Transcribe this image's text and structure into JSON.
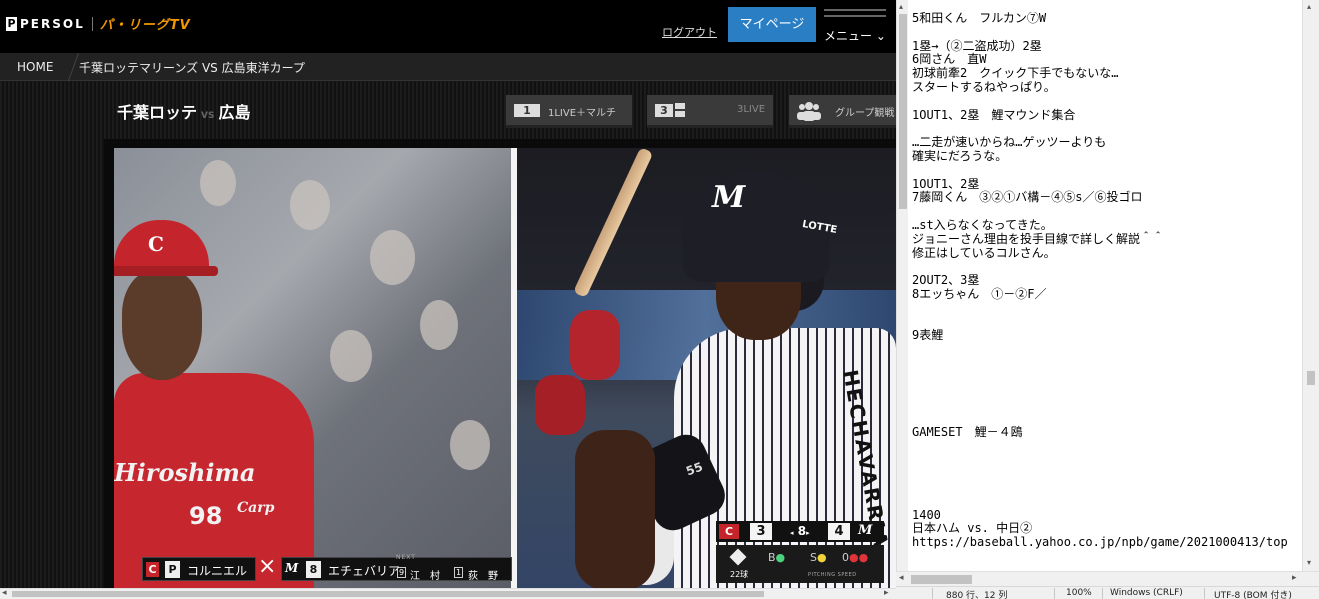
{
  "browser": {
    "site": {
      "logo_text": "PERSOL",
      "logo_tv": "パ・リーグTV",
      "logout_label": "ログアウト",
      "mypage_label": "マイページ",
      "menu_label": "メニュー"
    },
    "breadcrumb": {
      "home": "HOME",
      "current": "千葉ロッテマリーンズ VS 広島東洋カープ"
    },
    "game": {
      "home_team": "千葉ロッテ",
      "vs": "VS",
      "away_team": "広島"
    },
    "view_buttons": [
      {
        "num": "1",
        "label": "1LIVE＋マルチ"
      },
      {
        "num": "3",
        "label": "3LIVE"
      },
      {
        "num": "",
        "label": "グループ観戦"
      }
    ],
    "video": {
      "lineup": {
        "pitcher_pos": "P",
        "pitcher_name": "コルニエル",
        "batter_num": "8",
        "batter_name": "エチェバリア",
        "next_label": "NEXT",
        "next1_num": "9",
        "next1_name": "江　村",
        "next2_num": "1",
        "next2_name": "荻　野"
      },
      "scoreboard": {
        "away_score": "3",
        "inning": "8",
        "home_score": "4",
        "balls_label": "B",
        "strikes_label": "S",
        "outs_label": "0",
        "pitch_count": "22球",
        "pitching_speed_label": "PITCHING SPEED"
      },
      "uniform_text": {
        "left_script": "Hiroshima",
        "left_number": "98",
        "left_carp": "Carp",
        "cap_letter": "C",
        "helmet_letter": "M",
        "helmet_sponsor": "LOTTE",
        "right_name": "HECHAVARRIA",
        "sleeve_number": "55"
      }
    }
  },
  "notepad": {
    "lines": [
      "5和田くん　フルカン⑦W",
      "",
      "1塁→（②二盗成功）2塁",
      "6岡さん　直W",
      "初球前牽2　クイック下手でもないな…",
      "スタートするねやっぱり。",
      "",
      "1OUT1、2塁　鯉マウンド集合",
      "",
      "…二走が速いからね…ゲッツーよりも",
      "確実にだろうな。",
      "",
      "1OUT1、2塁",
      "7藤岡くん　③②①バ構－④⑤s／⑥投ゴロ",
      "",
      "…st入らなくなってきた。",
      "ジョニーさん理由を投手目線で詳しく解説＾＾",
      "修正はしているコルさん。",
      "",
      "2OUT2、3塁",
      "8エッちゃん　①－②F／",
      "",
      "",
      "9表鯉",
      "",
      "",
      "",
      "",
      "",
      "",
      "GAMESET　鯉－４鴎",
      "",
      "",
      "",
      "",
      "",
      "1400",
      "日本ハム vs. 中日②",
      "https://baseball.yahoo.co.jp/npb/game/2021000413/top"
    ],
    "status": {
      "position": "880 行、12 列",
      "zoom": "100%",
      "line_ending": "Windows (CRLF)",
      "encoding": "UTF-8 (BOM 付き)"
    }
  }
}
